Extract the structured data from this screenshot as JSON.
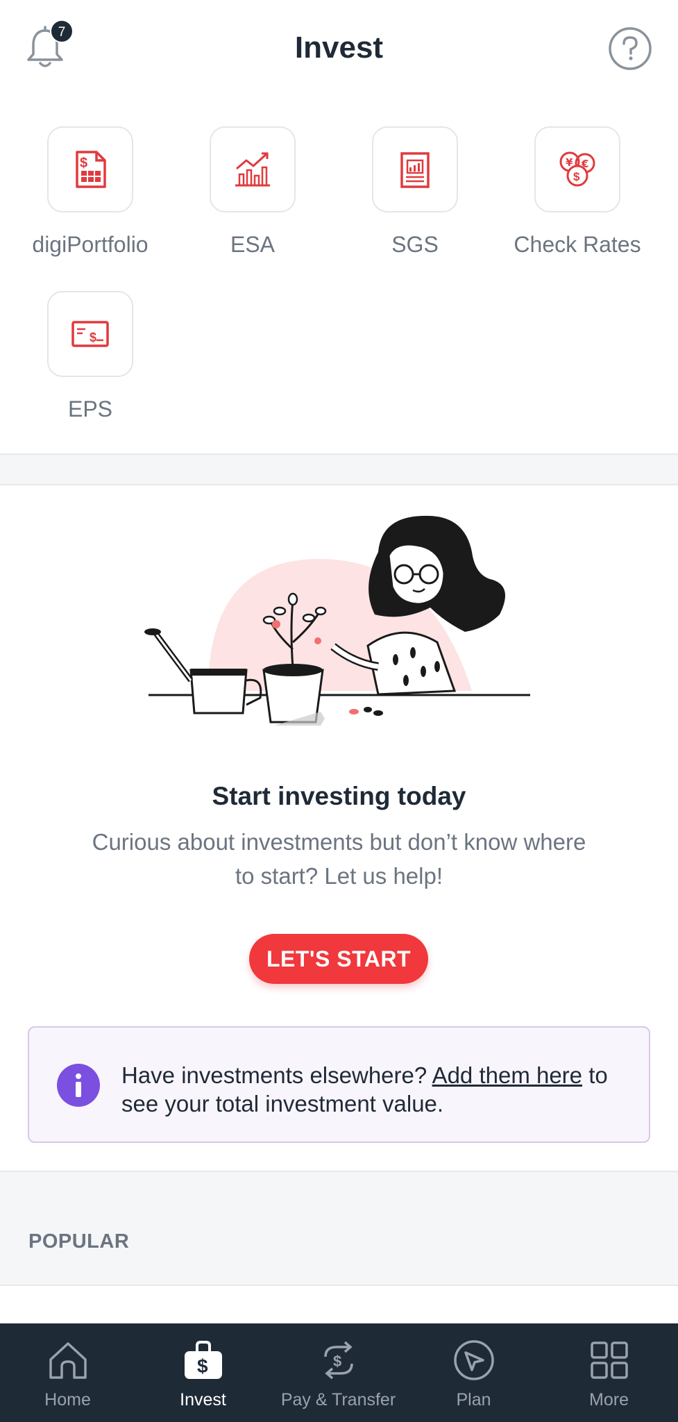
{
  "header": {
    "title": "Invest",
    "notifications_count": "7",
    "bell_icon": "bell-icon",
    "help_icon": "question-circle-icon"
  },
  "shortcuts": [
    {
      "label": "digiPortfolio",
      "icon": "portfolio-document-icon"
    },
    {
      "label": "ESA",
      "icon": "bar-chart-trend-icon"
    },
    {
      "label": "SGS",
      "icon": "bond-document-icon"
    },
    {
      "label": "Check Rates",
      "icon": "currency-coins-icon"
    },
    {
      "label": "EPS",
      "icon": "payment-card-icon"
    }
  ],
  "promo": {
    "title": "Start investing today",
    "description": "Curious about investments but don’t know where to start? Let us help!",
    "cta_label": "LET'S START"
  },
  "info": {
    "text_before": "Have investments elsewhere? ",
    "link_text": "Add them here",
    "text_after": " to see your total investment value."
  },
  "sections": {
    "popular_label": "POPULAR"
  },
  "bottom_nav": [
    {
      "label": "Home",
      "icon": "home-icon",
      "active": false
    },
    {
      "label": "Invest",
      "icon": "investment-bag-icon",
      "active": true
    },
    {
      "label": "Pay & Transfer",
      "icon": "transfer-icon",
      "active": false
    },
    {
      "label": "Plan",
      "icon": "navigation-pointer-icon",
      "active": false
    },
    {
      "label": "More",
      "icon": "grid-icon",
      "active": false
    }
  ],
  "colors": {
    "accent_red": "#f0383d",
    "nav_background": "#1f2a37",
    "info_purple": "#7b4fe0"
  }
}
